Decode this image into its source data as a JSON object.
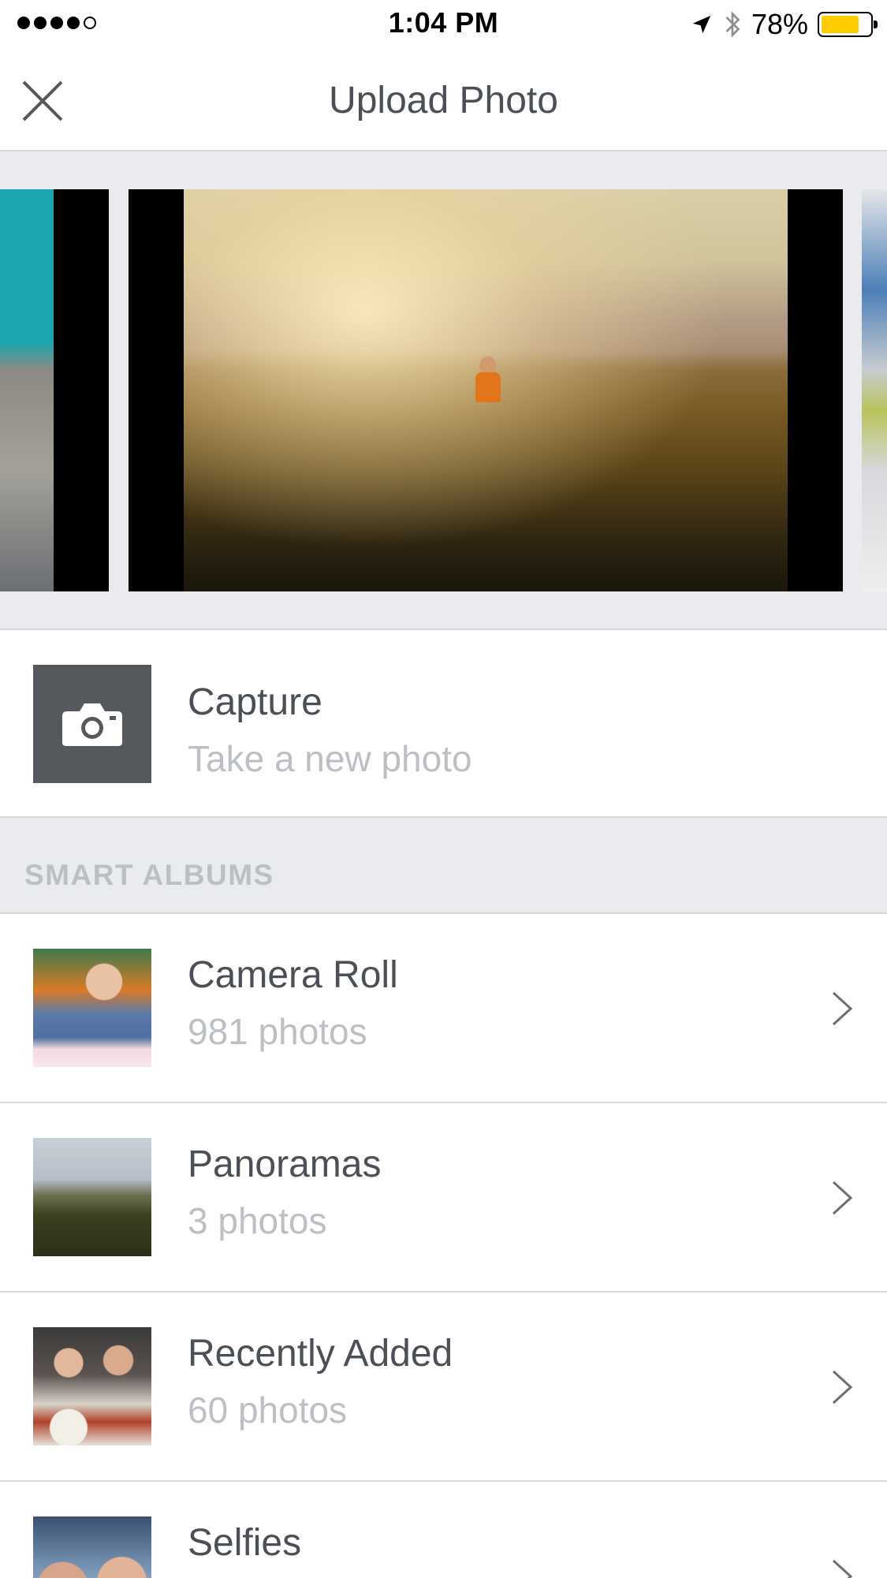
{
  "status_bar": {
    "time": "1:04 PM",
    "battery_percent": "78%",
    "battery_level": 0.78,
    "signal_bars_filled": 4,
    "signal_bars_total": 5,
    "icons": [
      "location-arrow-icon",
      "bluetooth-icon",
      "battery-icon"
    ]
  },
  "nav": {
    "title": "Upload Photo",
    "close_icon": "close-icon"
  },
  "carousel": {
    "photos": [
      "photo-left",
      "photo-center",
      "photo-right"
    ]
  },
  "capture": {
    "title": "Capture",
    "subtitle": "Take a new photo",
    "icon": "camera-icon"
  },
  "smart_albums": {
    "header": "SMART ALBUMS",
    "albums": [
      {
        "name": "Camera Roll",
        "count": "981 photos"
      },
      {
        "name": "Panoramas",
        "count": "3 photos"
      },
      {
        "name": "Recently Added",
        "count": "60 photos"
      },
      {
        "name": "Selfies",
        "count": ""
      }
    ]
  },
  "colors": {
    "background": "#ffffff",
    "section_bg": "#e9ebee",
    "divider": "#d7d8dc",
    "title_text": "#4b4f56",
    "secondary_text": "#bcc0c4",
    "capture_tile": "#55585c",
    "battery_fill": "#ffcc00"
  }
}
